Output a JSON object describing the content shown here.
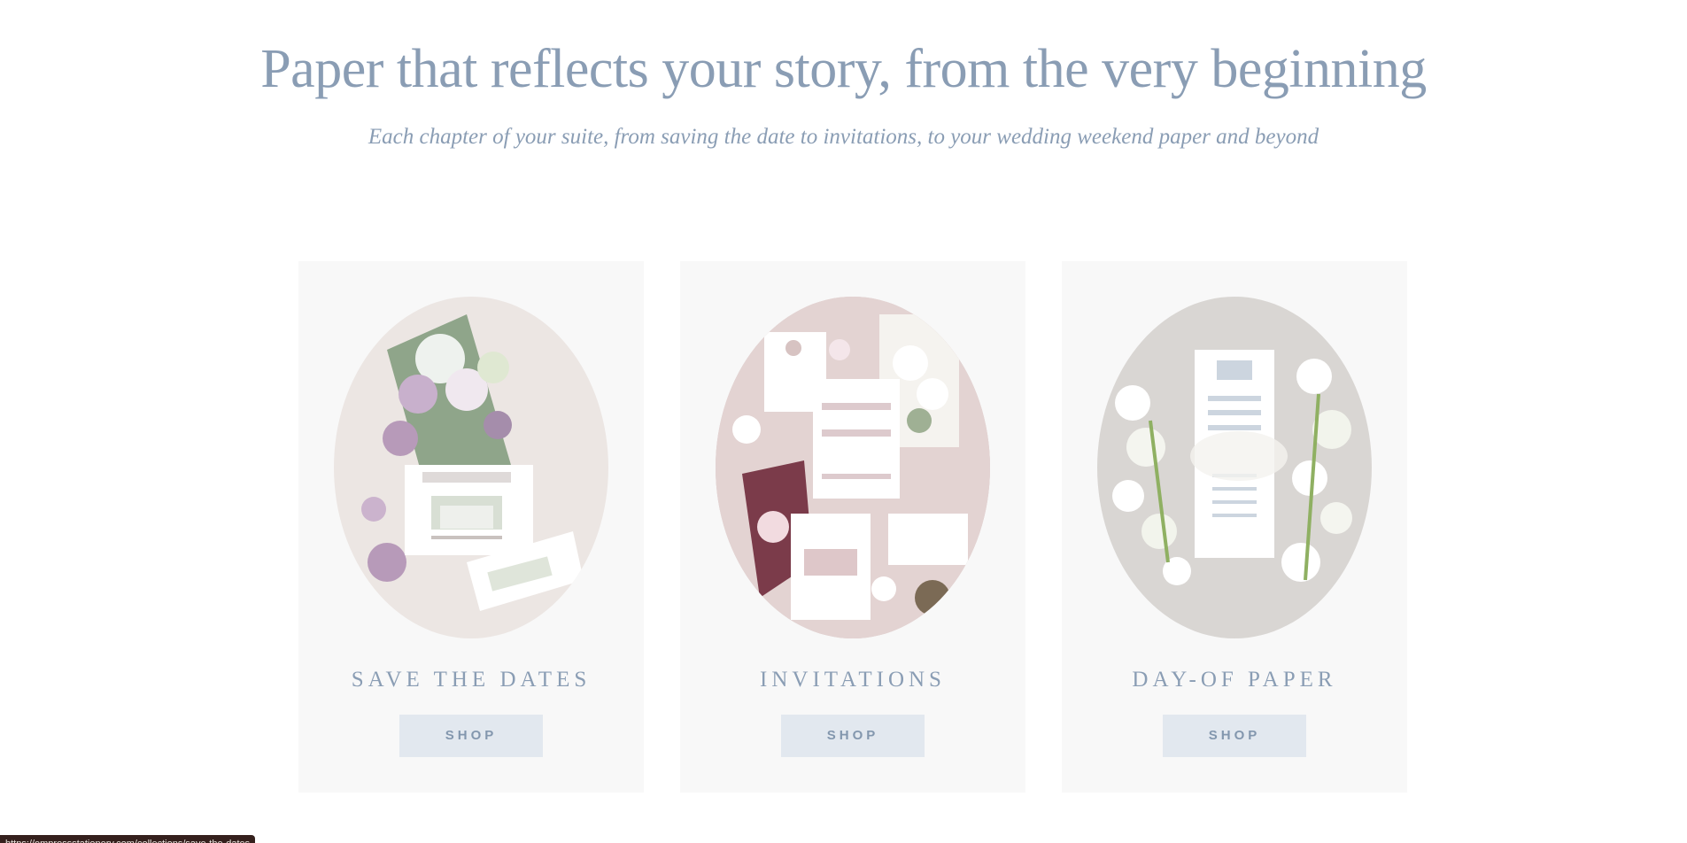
{
  "hero": {
    "title": "Paper that reflects your story, from the very beginning",
    "subtitle": "Each chapter of your suite, from saving the date to invitations, to your wedding weekend paper and beyond"
  },
  "cards": [
    {
      "title": "SAVE THE DATES",
      "button": "SHOP",
      "image": "save-the-date-flatlay-image"
    },
    {
      "title": "INVITATIONS",
      "button": "SHOP",
      "image": "invitation-suite-flatlay-image"
    },
    {
      "title": "DAY-OF PAPER",
      "button": "SHOP",
      "image": "day-of-paper-flatlay-image"
    }
  ],
  "status_bar": {
    "url": "https://empressstationery.com/collections/save-the-dates"
  },
  "colors": {
    "heading": "#8a9db4",
    "card_bg": "#f8f8f8",
    "button_bg": "#e2e8ef",
    "button_text": "#8397ae"
  }
}
